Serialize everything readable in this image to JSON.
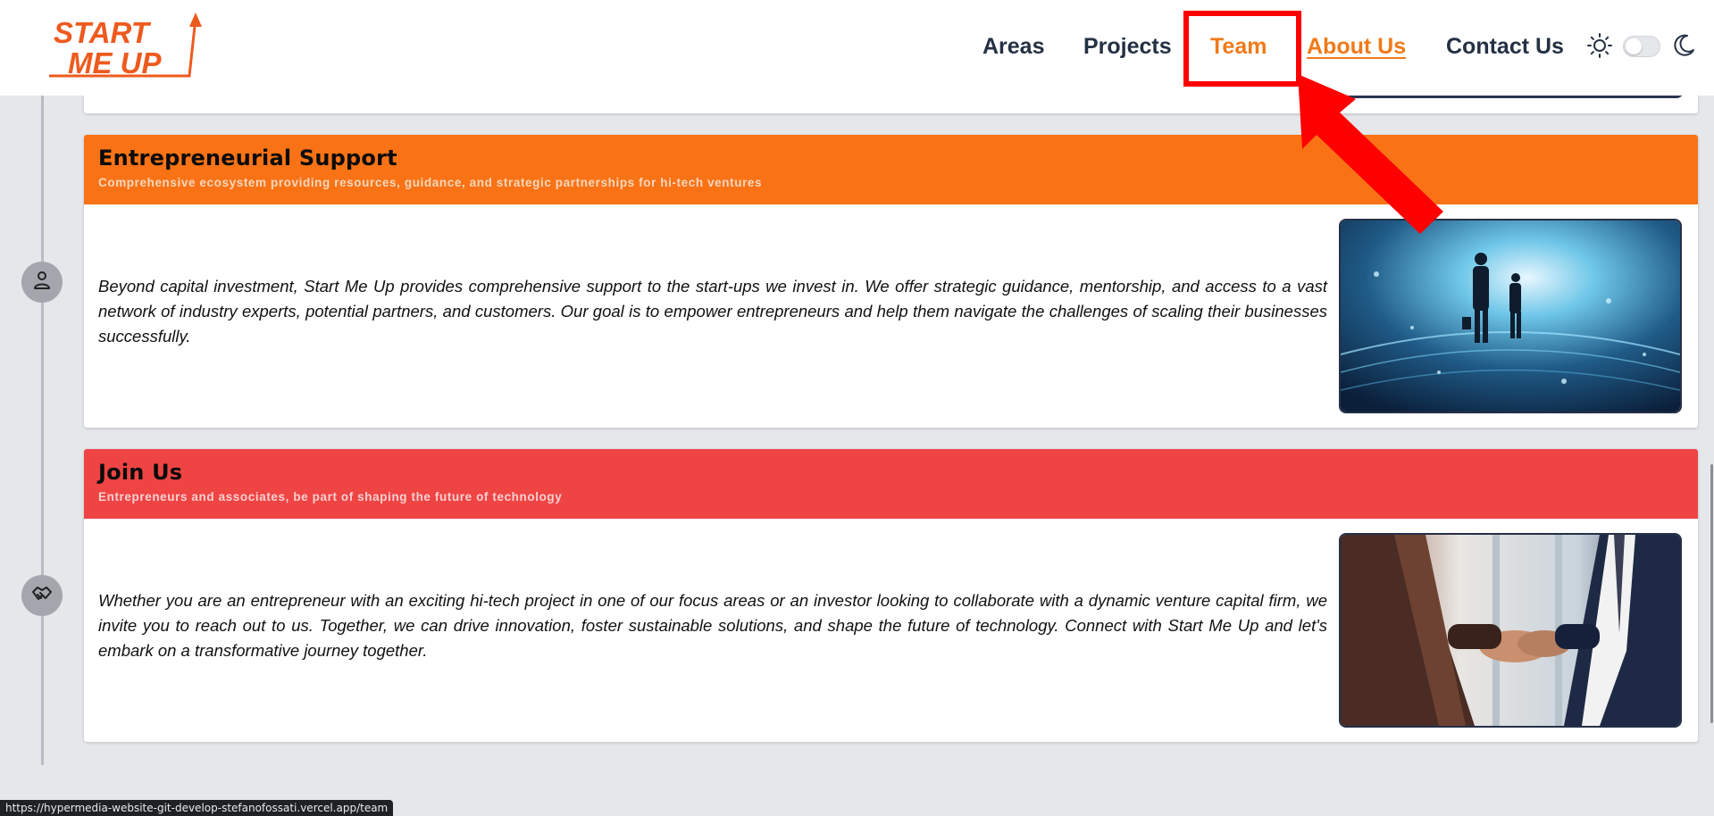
{
  "nav": {
    "logo_line1": "START",
    "logo_line2": "ME UP",
    "links": [
      "Areas",
      "Projects",
      "Team",
      "About Us",
      "Contact Us"
    ]
  },
  "theme": {
    "light_icon": "sun-icon",
    "dark_icon": "moon-icon",
    "dark_mode_enabled": false
  },
  "sections": [
    {
      "title": "Entrepreneurial Support",
      "subtitle": "Comprehensive ecosystem providing resources, guidance, and strategic partnerships for hi-tech ventures",
      "text": "Beyond capital investment, Start Me Up provides comprehensive support to the start-ups we invest in. We offer strategic guidance, mentorship, and access to a vast network of industry experts, potential partners, and customers. Our goal is to empower entrepreneurs and help them navigate the challenges of scaling their businesses successfully.",
      "icon": "person-icon",
      "header_color": "#f97316"
    },
    {
      "title": "Join Us",
      "subtitle": "Entrepreneurs and associates, be part of shaping the future of technology",
      "text": "Whether you are an entrepreneur with an exciting hi-tech project in one of our focus areas or an investor looking to collaborate with a dynamic venture capital firm, we invite you to reach out to us. Together, we can drive innovation, foster sustainable solutions, and shape the future of technology. Connect with Start Me Up and let's embark on a transformative journey together.",
      "icon": "handshake-icon",
      "header_color": "#ef4444"
    }
  ],
  "status_bar": {
    "url": "https://hypermedia-website-git-develop-stefanofossati.vercel.app/team"
  },
  "colors": {
    "accent": "#f07a1a",
    "nav_text": "#243044",
    "annotation": "#ff0000"
  }
}
